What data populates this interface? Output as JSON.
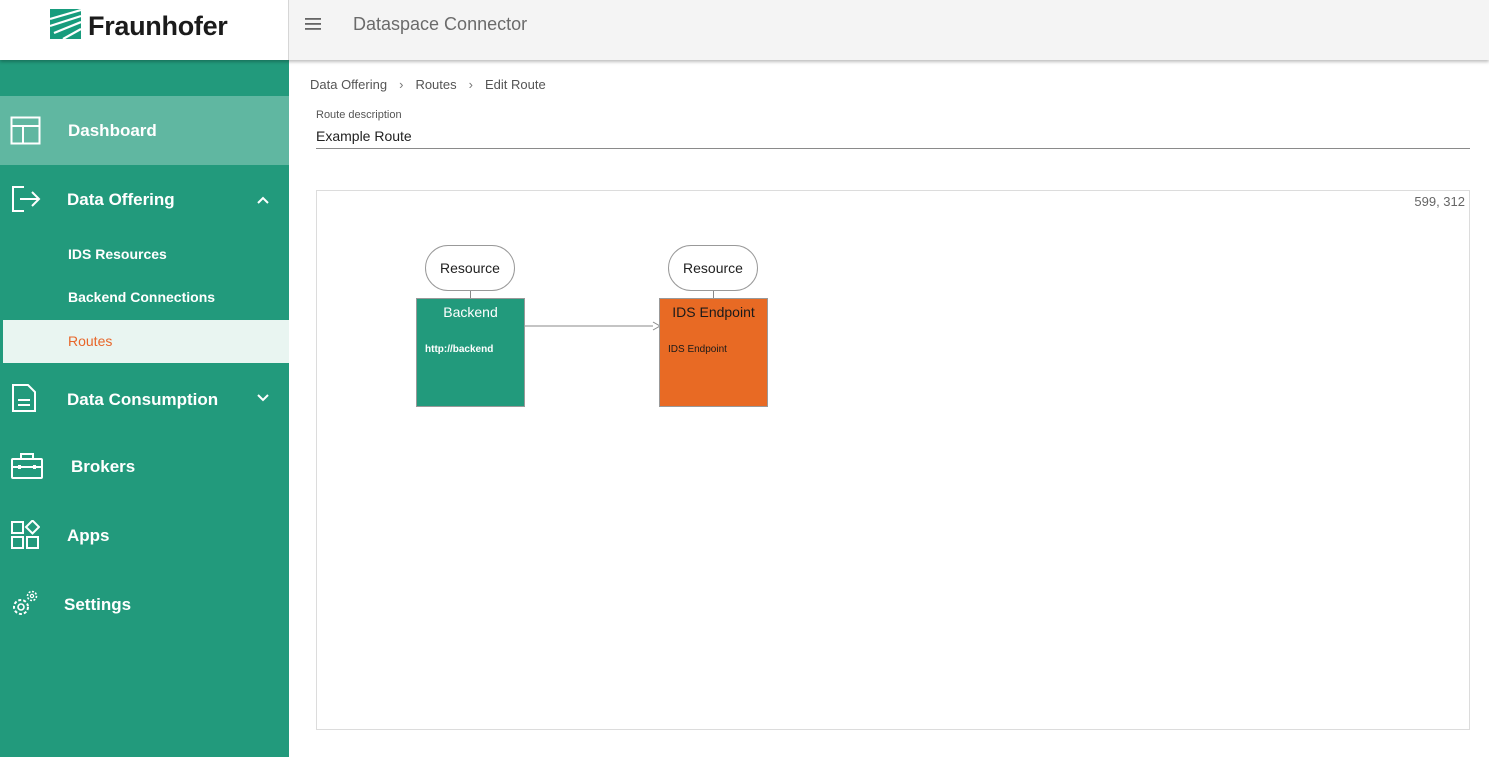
{
  "app": {
    "logo_text": "Fraunhofer",
    "title": "Dataspace Connector",
    "brand_color": "#229a7c",
    "accent_color": "#e8662a"
  },
  "sidebar": {
    "dashboard": "Dashboard",
    "data_offering": "Data Offering",
    "data_offering_sub": [
      "IDS Resources",
      "Backend Connections",
      "Routes"
    ],
    "data_consumption": "Data Consumption",
    "brokers": "Brokers",
    "apps": "Apps",
    "settings": "Settings"
  },
  "breadcrumb": [
    "Data Offering",
    "Routes",
    "Edit Route"
  ],
  "form": {
    "description_label": "Route description",
    "description_value": "Example Route"
  },
  "editor": {
    "coords": "599, 312",
    "nodes": [
      {
        "resource_label": "Resource",
        "title": "Backend",
        "subtitle": "http://backend",
        "color": "#229a7c"
      },
      {
        "resource_label": "Resource",
        "title": "IDS Endpoint",
        "subtitle": "IDS Endpoint",
        "color": "#e86a24"
      }
    ]
  }
}
